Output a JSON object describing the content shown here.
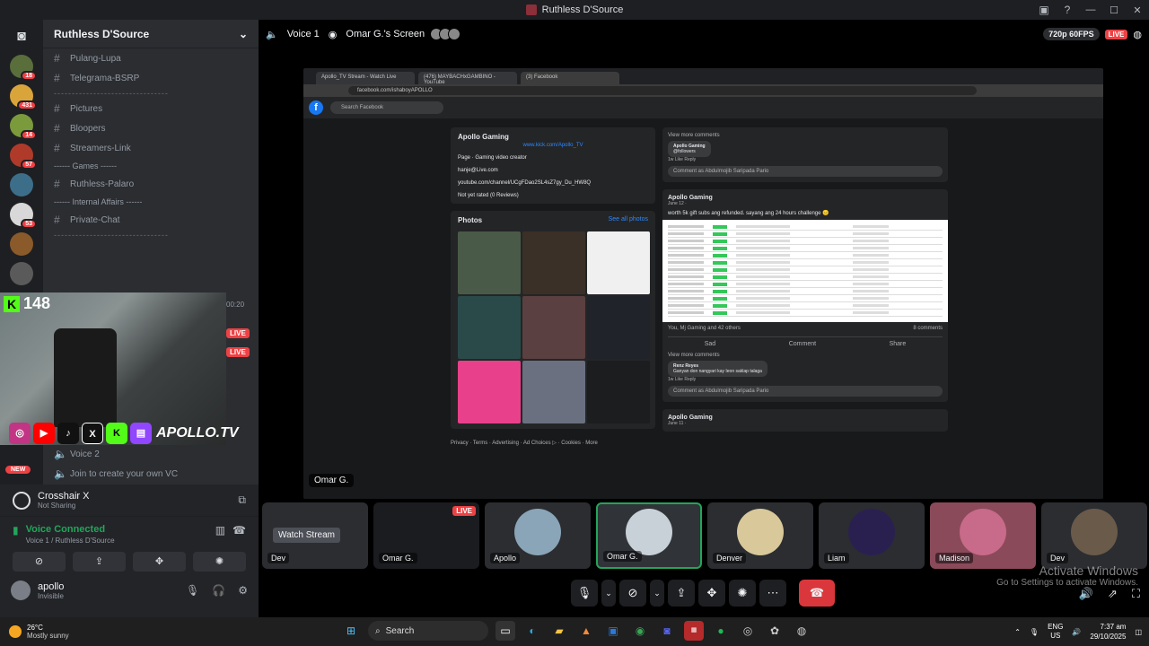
{
  "window": {
    "title": "Ruthless D'Source"
  },
  "server": {
    "name": "Ruthless D'Source"
  },
  "guilds": [
    {
      "badge": "18",
      "color": "#5a6e3c"
    },
    {
      "badge": "431",
      "color": "#d9a53a"
    },
    {
      "badge": "14",
      "color": "#7a9a3c"
    },
    {
      "badge": "57",
      "color": "#b03a2a"
    },
    {
      "badge": "",
      "color": "#3c6e8a"
    },
    {
      "badge": "53",
      "color": "#d8d8d8"
    },
    {
      "badge": "",
      "color": "#8a5a2a"
    },
    {
      "badge": "",
      "color": "#5a5a5a"
    }
  ],
  "channels": {
    "c1": "Pulang-Lupa",
    "c2": "Telegrama-BSRP",
    "divider1": "--------------------------------",
    "c3": "Pictures",
    "c4": "Bloopers",
    "c5": "Streamers-Link",
    "cat_games": "------ Games ------",
    "c6": "Ruthless-Palaro",
    "cat_internal": "------ Internal Affairs ------",
    "c7": "Private-Chat",
    "divider2": "--------------------------------",
    "c8": "Voice 2",
    "c9": "Join to create your own VC"
  },
  "overlay": {
    "kick_count": "148",
    "brand": "APOLLO.TV",
    "timer": "00:20",
    "live1": "LIVE",
    "live2": "LIVE",
    "new": "NEW"
  },
  "activity": {
    "title": "Crosshair X",
    "status": "Not Sharing"
  },
  "voice": {
    "status": "Voice Connected",
    "location": "Voice 1 / Ruthless D'Source"
  },
  "user": {
    "name": "apollo",
    "status": "Invisible"
  },
  "header": {
    "channel": "Voice 1",
    "screen": "Omar G.'s Screen",
    "quality": "720p 60FPS",
    "live": "LIVE"
  },
  "stream": {
    "tabs": [
      "Apollo_TV Stream - Watch Live",
      "(476) MAYBACHxGAMBINO - YouTube",
      "(3) Facebook"
    ],
    "url": "facebook.com/ishaboyAPOLLO",
    "fb_search": "Search Facebook",
    "page_name": "Apollo Gaming",
    "kick_link": "www.kick.com/Apollo_TV",
    "intro": [
      "Page · Gaming video creator",
      "hanje@Live.com",
      "youtube.com/channel/UCgFDao2SL4sZ7gy_Du_HW8Q",
      "Not yet rated (0 Reviews)"
    ],
    "photos_title": "Photos",
    "see_all": "See all photos",
    "footer": "Privacy · Terms · Advertising · Ad Choices ▷ · Cookies · More",
    "view_more": "View more comments",
    "comment1_name": "Apollo Gaming",
    "comment1_text": "@followers",
    "comment_actions": "1w   Like   Reply",
    "comment_input": "Comment as Abdulmojib Saripada Pario",
    "post_name": "Apollo Gaming",
    "post_date": "June 12 ·",
    "post_text": "worth 5k gift subs ang refunded. sayang ang 24 hours challenge 😑",
    "reactions": "You, Mj Gaming and 42 others",
    "comments_count": "8 comments",
    "act_sad": "Sad",
    "act_comment": "Comment",
    "act_share": "Share",
    "view_more2": "View more comments",
    "comment2_name": "Renz Reyes",
    "comment2_text": "Ganyan don nangyari kay Ieon saklap talaga",
    "comment2_actions": "1w   Like   Reply",
    "comment_input2": "Comment as Abdulmojib Saripada Pario",
    "post2_name": "Apollo Gaming",
    "post2_date": "June 11 ·",
    "presenter_tag": "Omar G."
  },
  "tiles": [
    {
      "label": "Dev",
      "watch": "Watch Stream",
      "color": "#3a3d42"
    },
    {
      "label": "Omar G.",
      "color": "#1b1c1f"
    },
    {
      "label": "Apollo",
      "color": "#8aa4b8"
    },
    {
      "label": "Omar G.",
      "color": "#c8d0d8"
    },
    {
      "label": "Denver",
      "color": "#d8c89a"
    },
    {
      "label": "Liam",
      "color": "#2a2050"
    },
    {
      "label": "Madison",
      "color": "#c86a8a"
    },
    {
      "label": "Dev",
      "color": "#6a5a4a"
    }
  ],
  "tile_live": "LIVE",
  "activate": {
    "line1": "Activate Windows",
    "line2": "Go to Settings to activate Windows."
  },
  "taskbar": {
    "temp": "26°C",
    "weather": "Mostly sunny",
    "search": "Search",
    "lang1": "ENG",
    "lang2": "US",
    "time": "7:37 am",
    "date": "29/10/2025"
  }
}
